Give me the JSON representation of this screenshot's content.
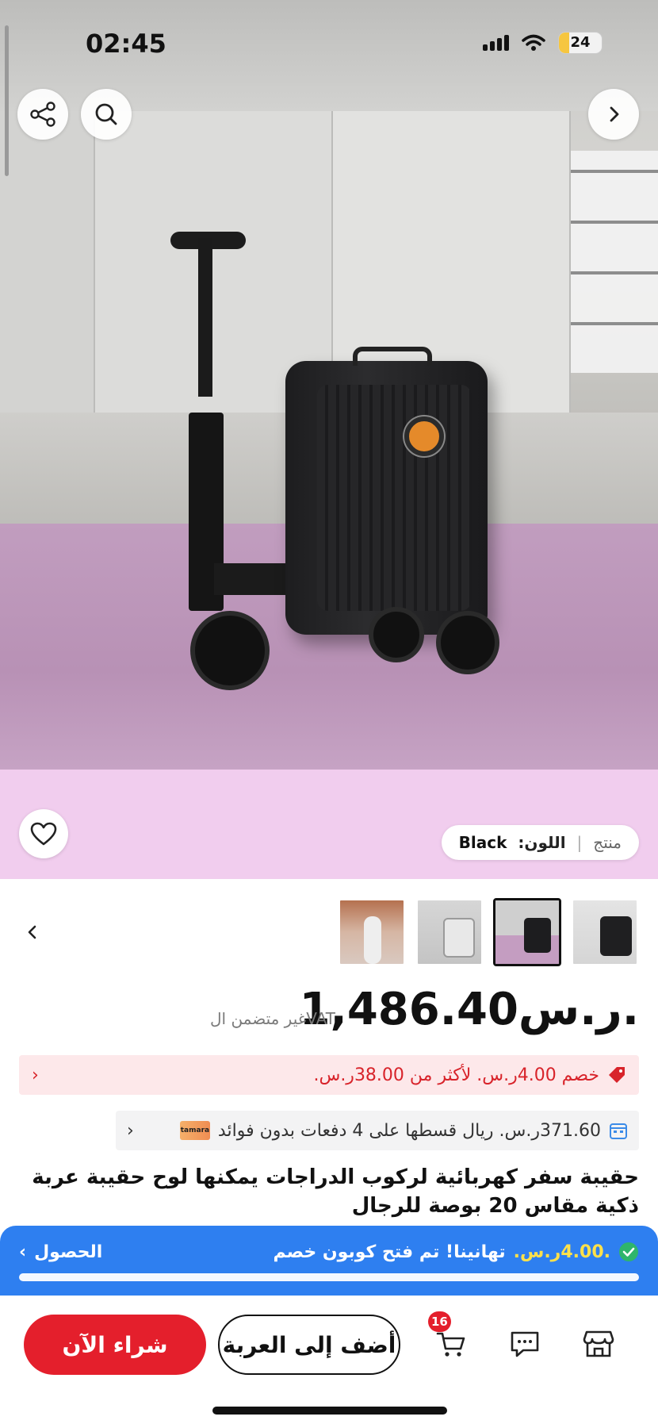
{
  "status_bar": {
    "time": "02:45",
    "battery": "24",
    "battery_level": 0.24
  },
  "product": {
    "color_label": "اللون:",
    "color_value": "Black",
    "variant_label": "منتج",
    "price": "1,486.40ر.س.",
    "vat_note": "غير متضمن الVAT",
    "discount_text": "خصم 4.00ر.س. لأكثر من 38.00ر.س.",
    "installment_text": "371.60ر.س. ريال قسطها على 4 دفعات بدون فوائد",
    "installment_provider": "tamara",
    "title": "حقيبة سفر كهربائية لركوب الدراجات يمكنها لوح حقيبة عربة ذكية مقاس 20 بوصة للرجال"
  },
  "thumbnails": [
    {
      "name": "thumb-1",
      "selected": false
    },
    {
      "name": "thumb-2",
      "selected": true
    },
    {
      "name": "thumb-3",
      "selected": false
    },
    {
      "name": "thumb-4",
      "selected": false
    }
  ],
  "coupon": {
    "amount": ".4.00ر.س.",
    "message": "تهانينا! تم فتح كوبون خصم",
    "claim_label": "الحصول",
    "progress": 1.0
  },
  "bottom_bar": {
    "buy_now_label": "شراء الآن",
    "add_to_cart_label": "أضف إلى العربة",
    "cart_count": "16"
  },
  "icons": [
    "share-icon",
    "search-icon",
    "forward-chevron-icon",
    "heart-icon",
    "chevron-left-icon",
    "tag-icon",
    "calendar-icon",
    "check-icon",
    "cart-icon",
    "chat-icon",
    "store-icon"
  ],
  "colors": {
    "accent_red": "#e41f2c",
    "coupon_blue": "#2e7ff0",
    "highlight_yellow": "#ffe14a"
  }
}
